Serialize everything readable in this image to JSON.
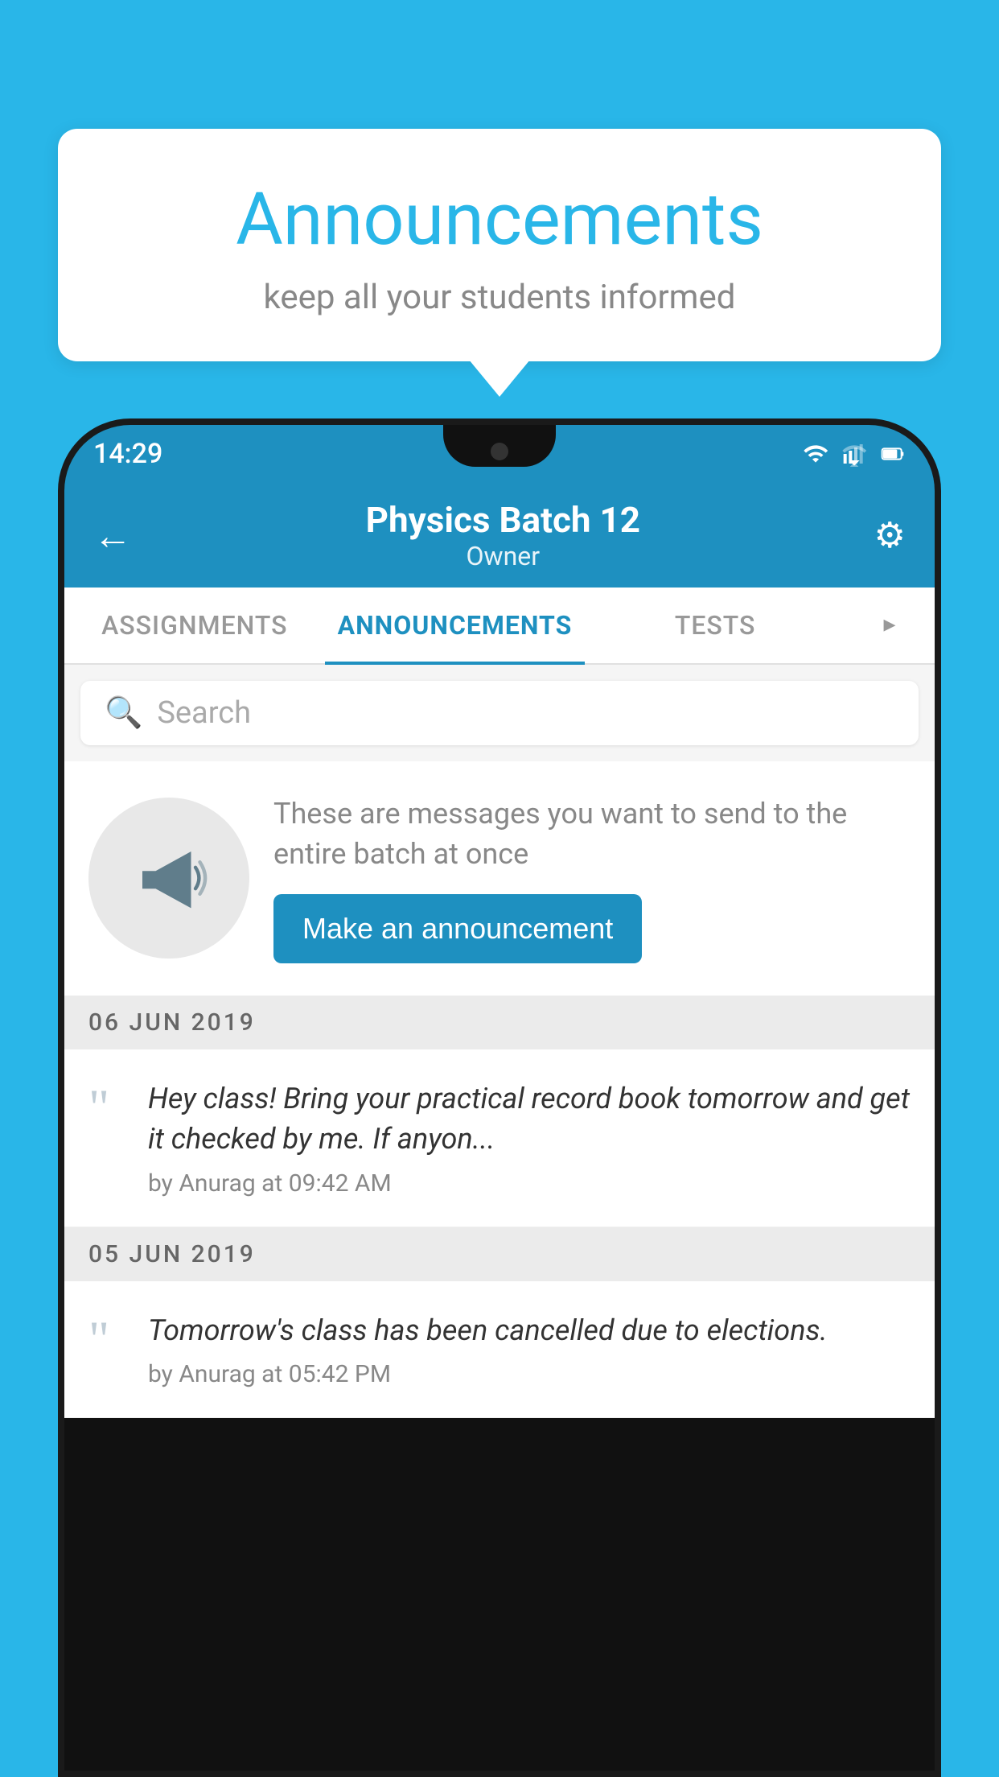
{
  "background_color": "#29b6e8",
  "announcement_card": {
    "title": "Announcements",
    "subtitle": "keep all your students informed"
  },
  "phone": {
    "status_bar": {
      "time": "14:29"
    },
    "header": {
      "title": "Physics Batch 12",
      "subtitle": "Owner",
      "back_icon": "←",
      "gear_icon": "⚙"
    },
    "tabs": [
      {
        "label": "ASSIGNMENTS",
        "active": false
      },
      {
        "label": "ANNOUNCEMENTS",
        "active": true
      },
      {
        "label": "TESTS",
        "active": false
      },
      {
        "label": "...",
        "active": false
      }
    ],
    "search": {
      "placeholder": "Search"
    },
    "prompt": {
      "text": "These are messages you want to send to the entire batch at once",
      "button_label": "Make an announcement"
    },
    "announcements": [
      {
        "date": "06  JUN  2019",
        "message": "Hey class! Bring your practical record book tomorrow and get it checked by me. If anyon...",
        "author": "by Anurag at 09:42 AM"
      },
      {
        "date": "05  JUN  2019",
        "message": "Tomorrow's class has been cancelled due to elections.",
        "author": "by Anurag at 05:42 PM"
      }
    ]
  }
}
